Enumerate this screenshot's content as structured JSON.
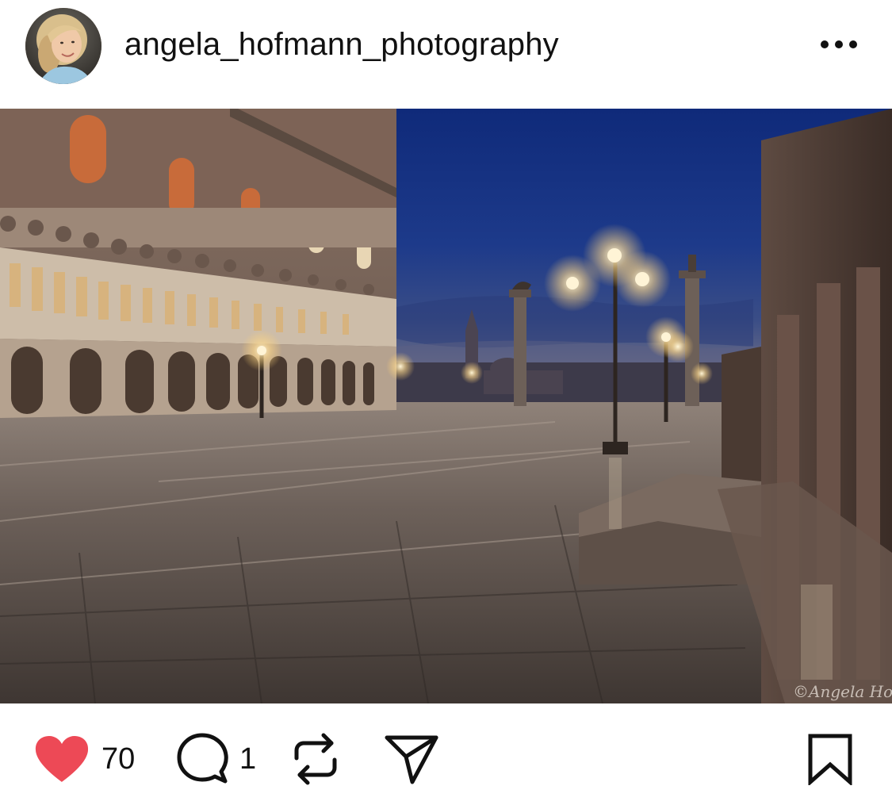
{
  "post": {
    "author": {
      "username": "angela_hofmann_photography",
      "avatar_icon": "profile-avatar"
    },
    "more_icon": "more-horizontal-icon",
    "photo": {
      "description_icon": "photo",
      "watermark": "©Angela Hofmann"
    },
    "actions": {
      "like": {
        "icon": "heart-icon",
        "count": "70",
        "color": "#ed4956",
        "liked": true
      },
      "comment": {
        "icon": "comment-icon",
        "count": "1"
      },
      "repost": {
        "icon": "repost-icon"
      },
      "share": {
        "icon": "send-icon"
      },
      "bookmark": {
        "icon": "bookmark-icon"
      }
    }
  }
}
